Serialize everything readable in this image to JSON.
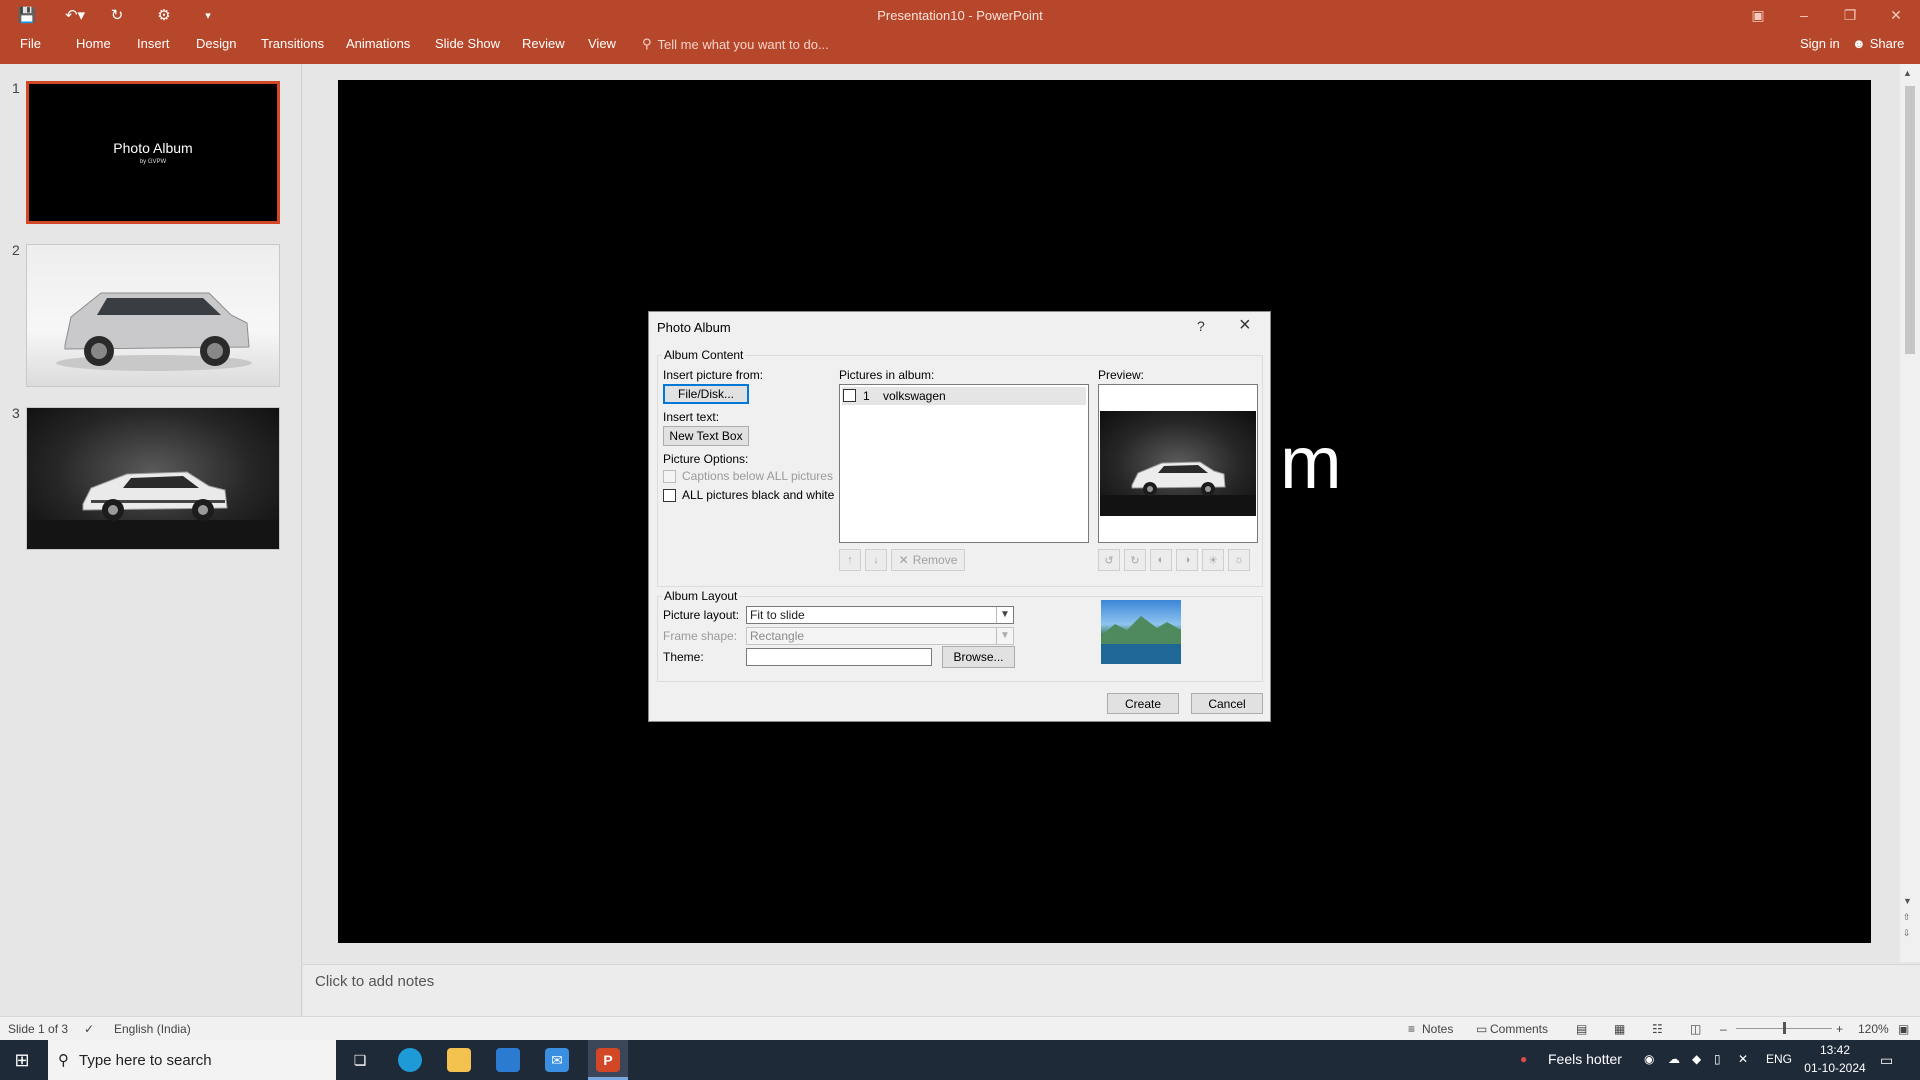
{
  "app": {
    "title": "Presentation10 - PowerPoint",
    "tabs": [
      "File",
      "Home",
      "Insert",
      "Design",
      "Transitions",
      "Animations",
      "Slide Show",
      "Review",
      "View"
    ],
    "tell_me": "Tell me what you want to do...",
    "sign_in": "Sign in",
    "share": "Share",
    "accent_color": "#b7472a"
  },
  "thumbnails": [
    {
      "number": "1",
      "title": "Photo Album",
      "subtitle": "by GVPW",
      "selected": true
    },
    {
      "number": "2",
      "image": "silver-suv-photo"
    },
    {
      "number": "3",
      "image": "white-hatchback-photo"
    }
  ],
  "slide": {
    "visible_text_fragment": "m"
  },
  "notes_placeholder": "Click to add notes",
  "status": {
    "slide_info": "Slide 1 of 3",
    "language": "English (India)",
    "notes": "Notes",
    "comments": "Comments",
    "zoom": "120%"
  },
  "dialog": {
    "title": "Photo Album",
    "help": "?",
    "album_content": "Album Content",
    "insert_picture_from": "Insert picture from:",
    "file_disk": "File/Disk...",
    "insert_text": "Insert text:",
    "new_text_box": "New Text Box",
    "picture_options": "Picture Options:",
    "captions_below": "Captions below ALL pictures",
    "all_black_white": "ALL pictures black and white",
    "pictures_in_album": "Pictures in album:",
    "album_items": [
      {
        "index": "1",
        "name": "volkswagen"
      }
    ],
    "preview": "Preview:",
    "remove": "Remove",
    "album_layout": "Album Layout",
    "picture_layout_label": "Picture layout:",
    "picture_layout_value": "Fit to slide",
    "frame_shape_label": "Frame shape:",
    "frame_shape_value": "Rectangle",
    "theme_label": "Theme:",
    "theme_value": "",
    "browse": "Browse...",
    "create": "Create",
    "cancel": "Cancel"
  },
  "taskbar": {
    "search_placeholder": "Type here to search",
    "weather": "Feels hotter",
    "language": "ENG",
    "time": "13:42",
    "date": "01-10-2024"
  }
}
